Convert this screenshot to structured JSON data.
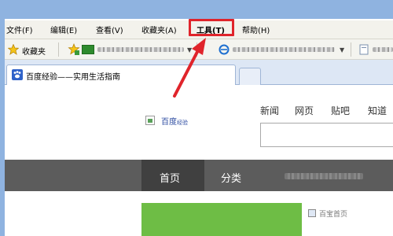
{
  "menu": {
    "items": [
      {
        "label": "文件(F)"
      },
      {
        "label": "编辑(E)"
      },
      {
        "label": "查看(V)"
      },
      {
        "label": "收藏夹(A)"
      },
      {
        "label": "工具(T)"
      },
      {
        "label": "帮助(H)"
      }
    ]
  },
  "favorites_bar": {
    "label": "收藏夹",
    "icons": [
      "star-icon",
      "add-favorite-icon",
      "ie-icon"
    ]
  },
  "tab": {
    "title": "百度经验——实用生活指南",
    "icon": "paw-icon"
  },
  "page": {
    "logo_text": "百度",
    "logo_sub": "经验",
    "top_nav": [
      "新闻",
      "网页",
      "贴吧",
      "知道"
    ],
    "nav_bar": [
      "首页",
      "分类"
    ],
    "side_text": "百宝首页"
  },
  "colors": {
    "highlight": "#e0242b",
    "arrow": "#e0242b",
    "navbar": "#5c5c5c",
    "accent_green": "#6ebd45"
  }
}
